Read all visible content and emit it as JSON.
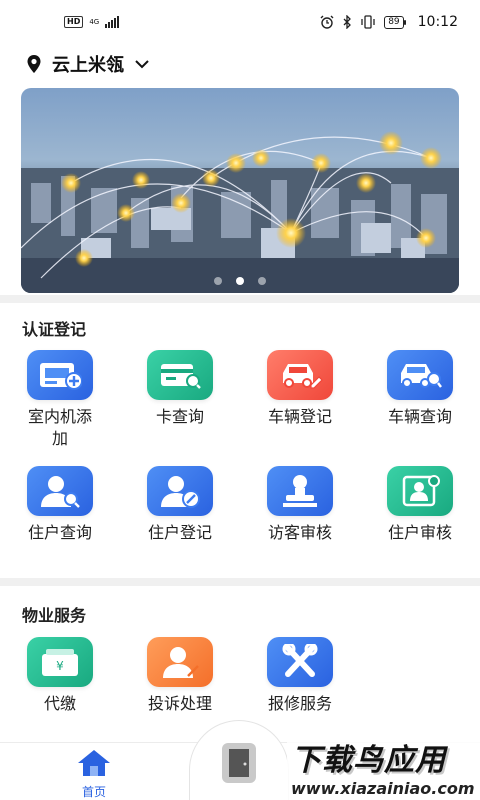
{
  "status_bar": {
    "hd": "HD",
    "network": "4G",
    "battery": "89",
    "time": "10:12"
  },
  "location": {
    "name": "云上米瓴",
    "icon": "location-pin-icon"
  },
  "banner": {
    "pages": 3,
    "active_page": 2
  },
  "sections": [
    {
      "title": "认证登记",
      "items": [
        {
          "label": "室内机添加",
          "icon": "indoor-unit-icon",
          "color": "#3d7cf0"
        },
        {
          "label": "卡查询",
          "icon": "card-search-icon",
          "color": "#22bf92"
        },
        {
          "label": "车辆登记",
          "icon": "car-register-icon",
          "color": "#f65a48"
        },
        {
          "label": "车辆查询",
          "icon": "car-search-icon",
          "color": "#3d7cf0"
        },
        {
          "label": "住户查询",
          "icon": "resident-search-icon",
          "color": "#3d7cf0"
        },
        {
          "label": "住户登记",
          "icon": "resident-register-icon",
          "color": "#3d7cf0"
        },
        {
          "label": "访客审核",
          "icon": "visitor-review-icon",
          "color": "#3d7cf0"
        },
        {
          "label": "住户审核",
          "icon": "resident-review-icon",
          "color": "#22bf92"
        }
      ]
    },
    {
      "title": "物业服务",
      "items": [
        {
          "label": "代缴",
          "icon": "payment-icon",
          "color": "#22bf92"
        },
        {
          "label": "投诉处理",
          "icon": "complaint-icon",
          "color": "#f88040"
        },
        {
          "label": "报修服务",
          "icon": "repair-icon",
          "color": "#3d7cf0"
        }
      ]
    }
  ],
  "bottom_nav": {
    "home_label": "首页",
    "center_icon": "door-icon"
  },
  "watermark": {
    "title": "下载鸟应用",
    "url": "www.xiazainiao.com"
  }
}
